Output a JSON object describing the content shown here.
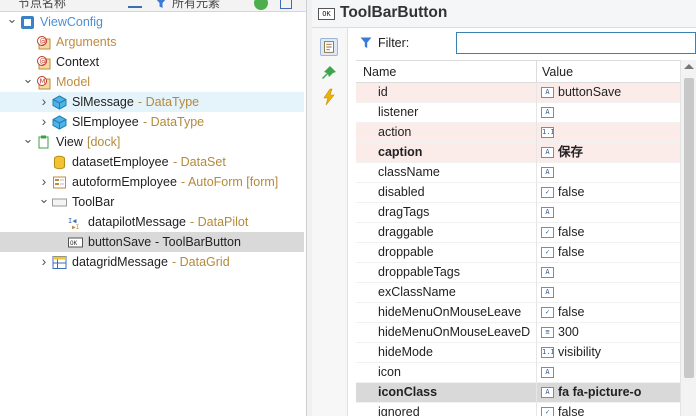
{
  "left_header": {
    "col_name": "节点名称",
    "filter_text": "所有元素"
  },
  "tree": [
    {
      "label": "ViewConfig",
      "type": "",
      "depth": 0,
      "expanded": "open",
      "icon": "viewconfig-icon",
      "color": "#4a8fd6"
    },
    {
      "label": "Arguments",
      "type": "",
      "depth": 1,
      "expanded": "none",
      "icon": "arguments-icon",
      "color": "#c28a3d"
    },
    {
      "label": "Context",
      "type": "",
      "depth": 1,
      "expanded": "none",
      "icon": "context-icon",
      "color": "#222222"
    },
    {
      "label": "Model",
      "type": "",
      "depth": 1,
      "expanded": "open",
      "icon": "model-icon",
      "color": "#c28a3d"
    },
    {
      "label": "SlMessage",
      "type": "- DataType",
      "depth": 2,
      "expanded": "closed",
      "icon": "datatype-icon",
      "color": "#222222",
      "state": "hover"
    },
    {
      "label": "SlEmployee",
      "type": "- DataType",
      "depth": 2,
      "expanded": "closed",
      "icon": "datatype-icon",
      "color": "#222222"
    },
    {
      "label": "View",
      "type": "[dock]",
      "depth": 1,
      "expanded": "open",
      "icon": "view-icon",
      "color": "#222222"
    },
    {
      "label": "datasetEmployee",
      "type": "- DataSet",
      "depth": 2,
      "expanded": "none",
      "icon": "dataset-icon",
      "color": "#222222"
    },
    {
      "label": "autoformEmployee",
      "type": "- AutoForm [form]",
      "depth": 2,
      "expanded": "closed",
      "icon": "autoform-icon",
      "color": "#222222"
    },
    {
      "label": "ToolBar",
      "type": "",
      "depth": 2,
      "expanded": "open",
      "icon": "toolbar-icon",
      "color": "#222222"
    },
    {
      "label": "datapilotMessage",
      "type": "- DataPilot",
      "depth": 3,
      "expanded": "none",
      "icon": "datapilot-icon",
      "color": "#222222"
    },
    {
      "label": "buttonSave",
      "type": "- ToolBarButton",
      "depth": 3,
      "expanded": "none",
      "icon": "toolbarbutton-icon",
      "color": "#222222",
      "state": "selected",
      "type_color": "#222222"
    },
    {
      "label": "datagridMessage",
      "type": "- DataGrid",
      "depth": 2,
      "expanded": "closed",
      "icon": "datagrid-icon",
      "color": "#222222"
    }
  ],
  "panel": {
    "title": "ToolBarButton",
    "title_icon_text": "OK",
    "filter_label": "Filter:",
    "filter_value": "",
    "col_name": "Name",
    "col_value": "Value"
  },
  "properties": [
    {
      "name": "id",
      "value": "buttonSave",
      "type_icon": "text-type-icon",
      "type_glyph": "A",
      "bold": false,
      "tint": true
    },
    {
      "name": "listener",
      "value": "",
      "type_icon": "text-type-icon",
      "type_glyph": "A",
      "bold": false,
      "tint": false
    },
    {
      "name": "action",
      "value": "",
      "type_icon": "number-type-icon",
      "type_glyph": "1.1",
      "bold": false,
      "tint": true
    },
    {
      "name": "caption",
      "value": "保存",
      "type_icon": "text-type-icon",
      "type_glyph": "A",
      "bold": true,
      "tint": true
    },
    {
      "name": "className",
      "value": "",
      "type_icon": "text-type-icon",
      "type_glyph": "A",
      "bold": false,
      "tint": false
    },
    {
      "name": "disabled",
      "value": "false",
      "type_icon": "boolean-type-icon",
      "type_glyph": "✓",
      "bold": false,
      "tint": false
    },
    {
      "name": "dragTags",
      "value": "",
      "type_icon": "text-type-icon",
      "type_glyph": "A",
      "bold": false,
      "tint": false
    },
    {
      "name": "draggable",
      "value": "false",
      "type_icon": "boolean-type-icon",
      "type_glyph": "✓",
      "bold": false,
      "tint": false
    },
    {
      "name": "droppable",
      "value": "false",
      "type_icon": "boolean-type-icon",
      "type_glyph": "✓",
      "bold": false,
      "tint": false
    },
    {
      "name": "droppableTags",
      "value": "",
      "type_icon": "text-type-icon",
      "type_glyph": "A",
      "bold": false,
      "tint": false
    },
    {
      "name": "exClassName",
      "value": "",
      "type_icon": "text-type-icon",
      "type_glyph": "A",
      "bold": false,
      "tint": false
    },
    {
      "name": "hideMenuOnMouseLeave",
      "value": "false",
      "type_icon": "boolean-type-icon",
      "type_glyph": "✓",
      "bold": false,
      "tint": false
    },
    {
      "name": "hideMenuOnMouseLeaveD",
      "value": "300",
      "type_icon": "integer-type-icon",
      "type_glyph": "≡",
      "bold": false,
      "tint": false
    },
    {
      "name": "hideMode",
      "value": "visibility",
      "type_icon": "number-type-icon",
      "type_glyph": "1.1",
      "bold": false,
      "tint": false
    },
    {
      "name": "icon",
      "value": "",
      "type_icon": "text-type-icon",
      "type_glyph": "A",
      "bold": false,
      "tint": false
    },
    {
      "name": "iconClass",
      "value": "fa fa-picture-o",
      "type_icon": "text-type-icon",
      "type_glyph": "A",
      "bold": true,
      "tint": false,
      "selected": true
    },
    {
      "name": "ignored",
      "value": "false",
      "type_icon": "boolean-type-icon",
      "type_glyph": "✓",
      "bold": false,
      "tint": false
    }
  ]
}
